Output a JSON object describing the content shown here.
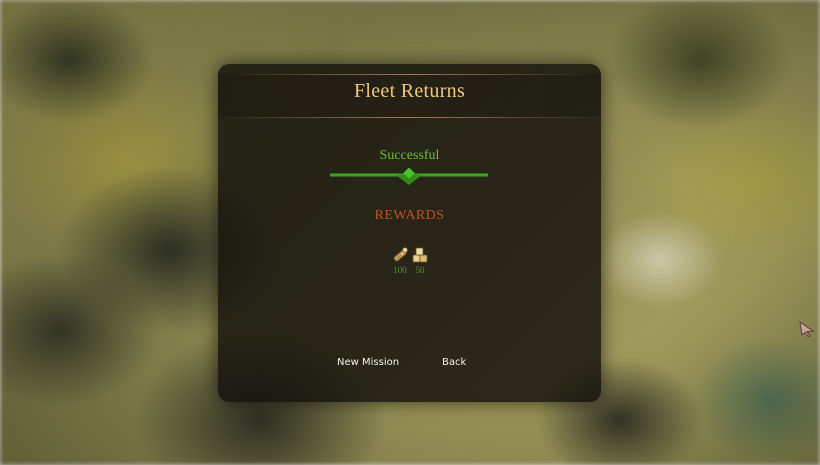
{
  "dialog": {
    "title": "Fleet Returns",
    "status": "Successful",
    "rewards_title": "REWARDS",
    "rewards": [
      {
        "icon": "wood-icon",
        "amount": "100"
      },
      {
        "icon": "gold-icon",
        "amount": "50"
      }
    ],
    "buttons": {
      "new_mission": "New Mission",
      "back": "Back"
    }
  },
  "colors": {
    "title": "#f0c878",
    "status": "#6cbf3a",
    "rewards_title": "#c0541f",
    "amount": "#4f9a2f",
    "button_text": "#f2f2ec"
  }
}
